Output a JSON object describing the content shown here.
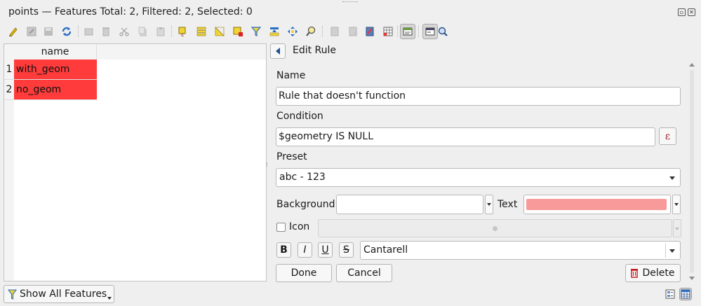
{
  "window": {
    "title": "points — Features Total: 2, Filtered: 2, Selected: 0"
  },
  "toolbar": {
    "icons": [
      "toggle-editing-icon",
      "multi-edit-icon",
      "save-edits-icon",
      "reload-icon",
      "add-feature-icon",
      "delete-feature-icon",
      "cut-icon",
      "copy-icon",
      "paste-icon",
      "select-by-expression-icon",
      "select-all-icon",
      "invert-selection-icon",
      "deselect-all-icon",
      "filter-icon",
      "move-selection-to-top-icon",
      "pan-to-selection-icon",
      "zoom-to-selection-icon",
      "new-field-icon",
      "delete-field-icon",
      "field-calculator-icon",
      "conditional-formatting-icon",
      "dock-icon",
      "actions-icon",
      "zoom-map-icon"
    ]
  },
  "table": {
    "column_header": "name",
    "rows": [
      {
        "index": "1",
        "name": "with_geom"
      },
      {
        "index": "2",
        "name": "no_geom"
      }
    ],
    "row_color": "#ff3b3b"
  },
  "edit_rule": {
    "title": "Edit Rule",
    "name_label": "Name",
    "name_value": "Rule that doesn't function",
    "condition_label": "Condition",
    "condition_value": "$geometry IS NULL",
    "expression_button": "ε",
    "preset_label": "Preset",
    "preset_value": "abc - 123",
    "background_label": "Background",
    "text_label": "Text",
    "text_color": "#f89a9a",
    "icon_label": "Icon",
    "bold": "B",
    "italic": "I",
    "underline": "U",
    "strike": "S",
    "font_value": "Cantarell",
    "done_button": "Done",
    "cancel_button": "Cancel",
    "delete_button": "Delete"
  },
  "status": {
    "show_all_label": "Show All Features"
  }
}
